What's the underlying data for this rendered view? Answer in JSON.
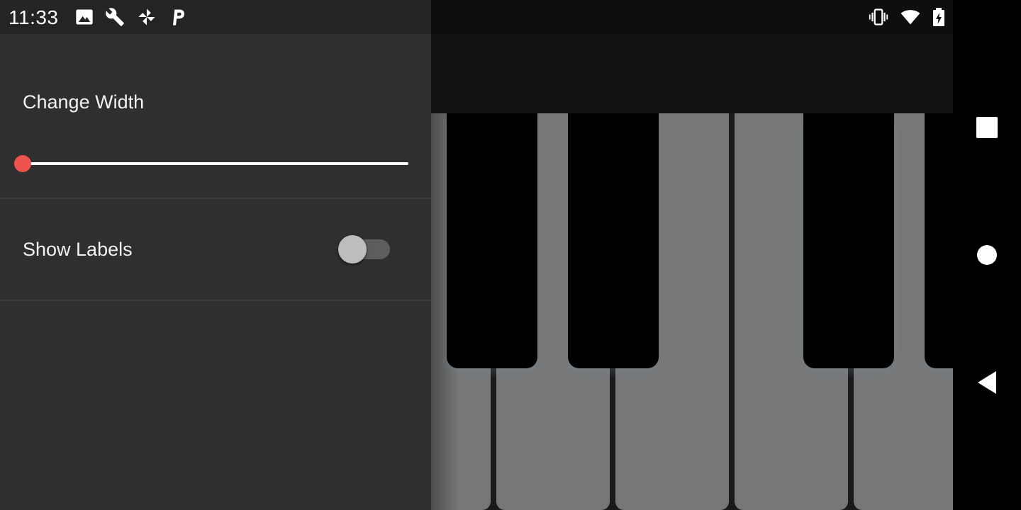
{
  "status_bar": {
    "time": "11:33",
    "left_icons": [
      "image-icon",
      "wrench-icon",
      "pinwheel-icon",
      "parking-icon"
    ],
    "right_icons": [
      "vibrate-icon",
      "wifi-icon",
      "battery-charging-icon"
    ]
  },
  "drawer": {
    "change_width_label": "Change Width",
    "width_slider_value": 0,
    "show_labels_label": "Show Labels",
    "show_labels_enabled": false,
    "accent_color": "#ef5350"
  },
  "keyboard": {
    "white_key_color": "#777777",
    "black_key_color": "#000000"
  },
  "nav_bar": {
    "buttons": [
      "recents-button",
      "home-button",
      "back-button"
    ]
  }
}
